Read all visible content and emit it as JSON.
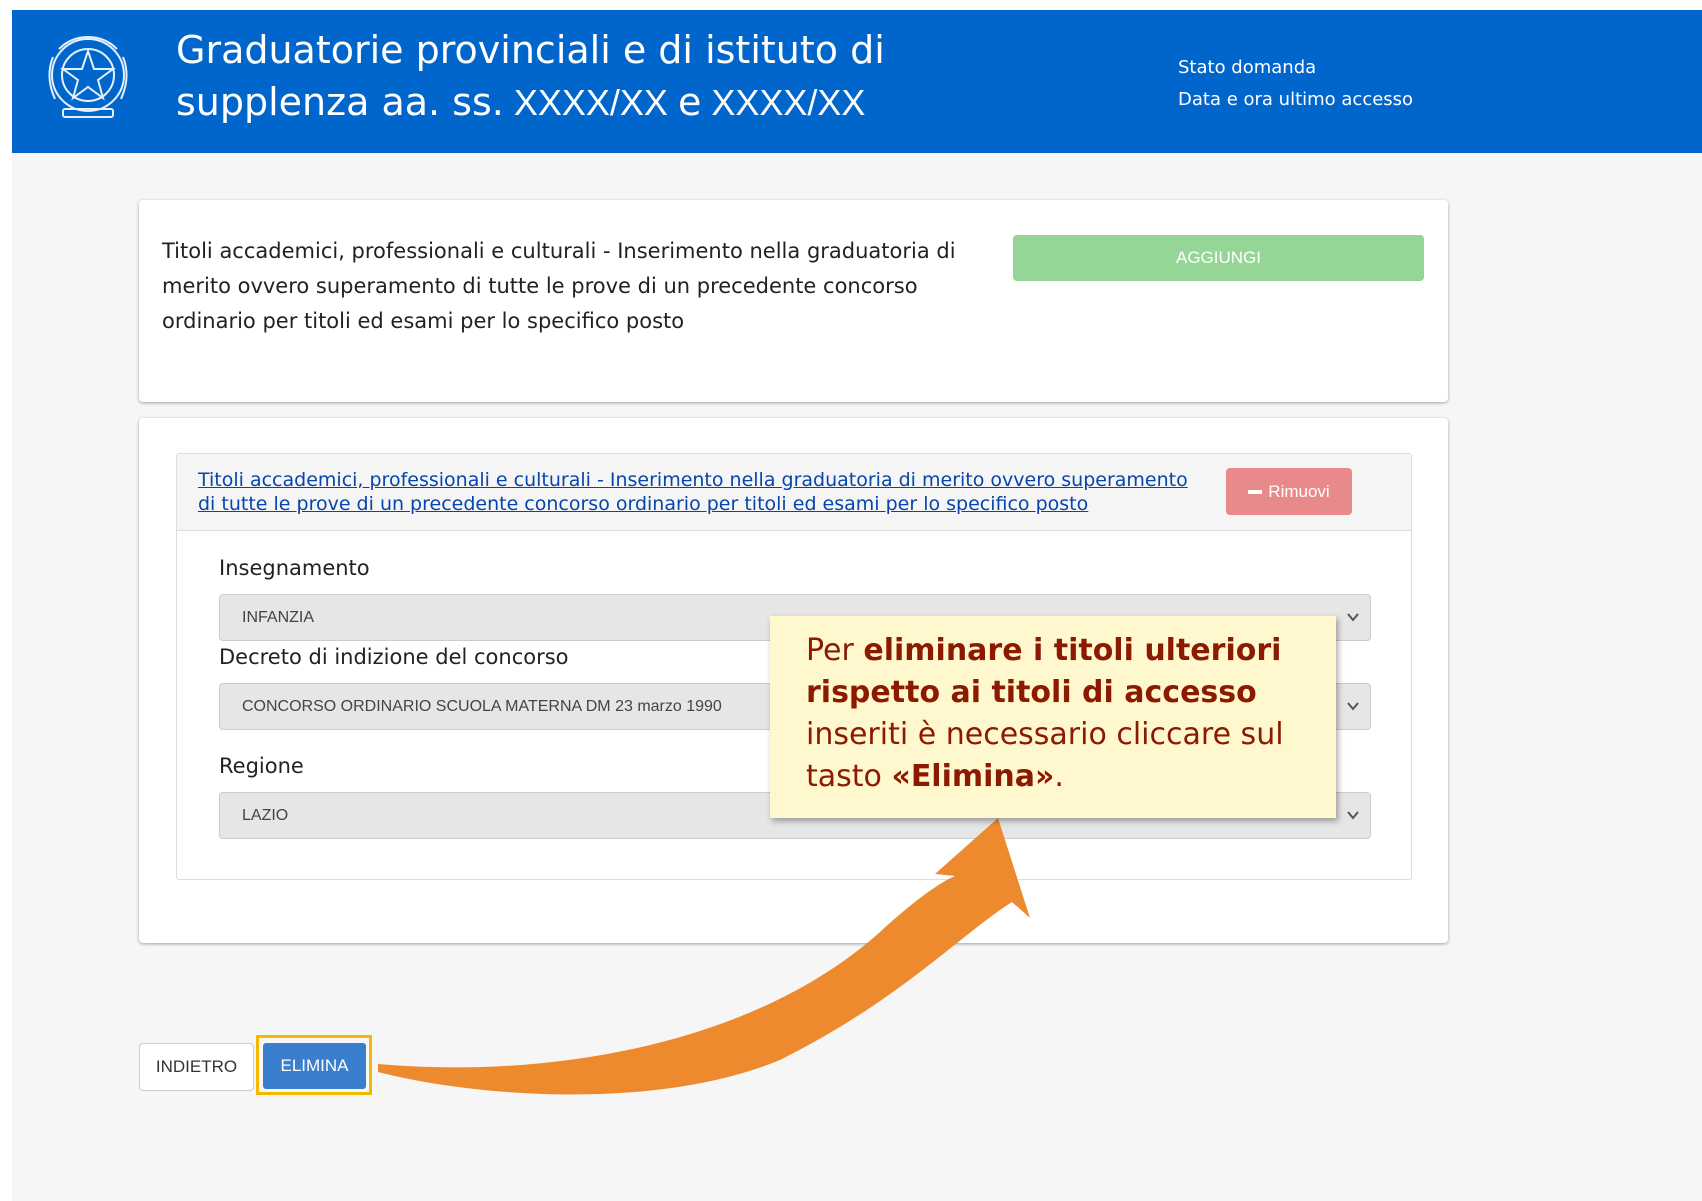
{
  "header": {
    "title_line1": "Graduatorie provinciali e di istituto di",
    "title_line2_prefix": "supplenza aa. ss.",
    "year1": "XXXX/XX",
    "and": "e",
    "year2": "XXXX/XX",
    "status_label": "Stato domanda",
    "last_access_label": "Data e ora ultimo accesso",
    "emblem_icon": "republic-emblem-icon"
  },
  "top_card": {
    "description": "Titoli accademici, professionali e culturali - Inserimento nella graduatoria di merito ovvero superamento di tutte le prove di un precedente concorso ordinario per titoli ed esami per lo specifico posto",
    "add_button": "AGGIUNGI"
  },
  "panel": {
    "title_link": "Titoli accademici, professionali e culturali - Inserimento nella graduatoria di merito ovvero superamento di tutte le prove di un precedente concorso ordinario per titoli ed esami per lo specifico posto",
    "remove_button": "Rimuovi",
    "fields": [
      {
        "label": "Insegnamento",
        "value": "INFANZIA"
      },
      {
        "label": "Decreto di indizione del concorso",
        "value": "CONCORSO ORDINARIO SCUOLA MATERNA DM 23 marzo 1990"
      },
      {
        "label": "Regione",
        "value": "LAZIO"
      }
    ]
  },
  "buttons": {
    "back": "INDIETRO",
    "delete": "ELIMINA"
  },
  "callout": {
    "part1": "Per ",
    "bold1": "eliminare i titoli ulteriori rispetto ai titoli di accesso",
    "part2": " inseriti è necessario cliccare sul tasto ",
    "bold2": "«Elimina»",
    "part3": "."
  },
  "colors": {
    "header_bg": "#0066cc",
    "add_button": "#95d596",
    "remove_button": "#e8898b",
    "delete_button": "#3a7fce",
    "highlight": "#f5b800",
    "callout_bg": "#fff8cf",
    "callout_text": "#8b1a00",
    "arrow": "#ee8a2e"
  }
}
